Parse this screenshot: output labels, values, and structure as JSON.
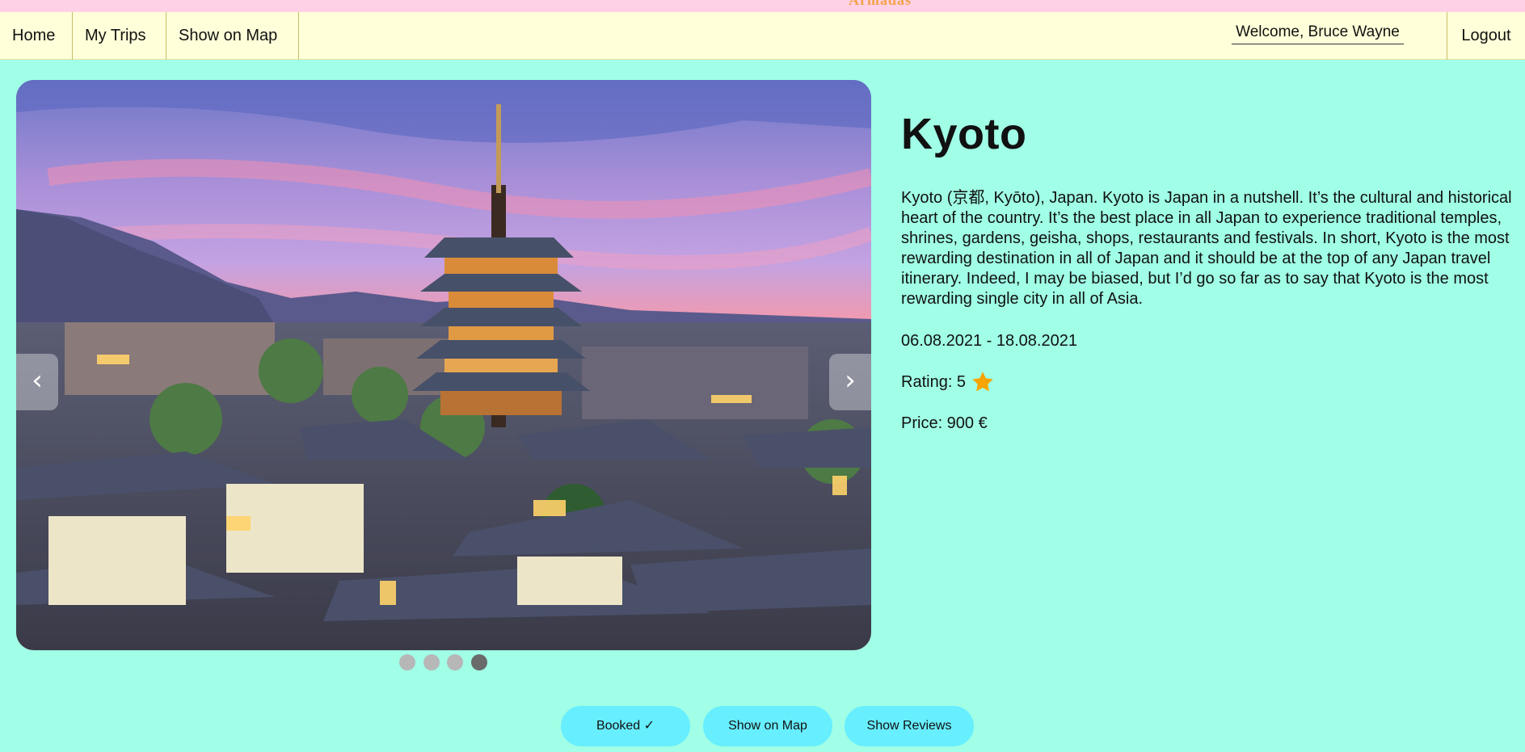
{
  "app": {
    "brand": "Armadas"
  },
  "nav": {
    "home": "Home",
    "my_trips": "My Trips",
    "show_on_map": "Show on Map",
    "welcome": "Welcome, Bruce Wayne",
    "logout": "Logout"
  },
  "carousel": {
    "prev_icon": "‹",
    "next_icon": "›",
    "slides": 4,
    "active_slide": 4
  },
  "trip": {
    "title": "Kyoto",
    "description": "Kyoto (京都, Kyōto), Japan. Kyoto is Japan in a nutshell. It’s the cultural and historical heart of the country. It’s the best place in all Japan to experience traditional temples, shrines, gardens, geisha, shops, restaurants and festivals. In short, Kyoto is the most rewarding destination in all of Japan and it should be at the top of any Japan travel itinerary. Indeed, I may be biased, but I’d go so far as to say that Kyoto is the most rewarding single city in all of Asia.",
    "dates": "06.08.2021 - 18.08.2021",
    "rating_label": "Rating: 5",
    "price_label": "Price: 900 €"
  },
  "actions": {
    "booked": "Booked ✓",
    "show_on_map": "Show on Map",
    "show_reviews": "Show Reviews"
  },
  "colors": {
    "page_bg": "#a0ffe6",
    "navbar_bg": "#ffffd9",
    "top_strip": "#ffd1e6",
    "button_bg": "#67eeff",
    "star": "#f7a400"
  },
  "icons": {
    "star": "star-icon"
  }
}
